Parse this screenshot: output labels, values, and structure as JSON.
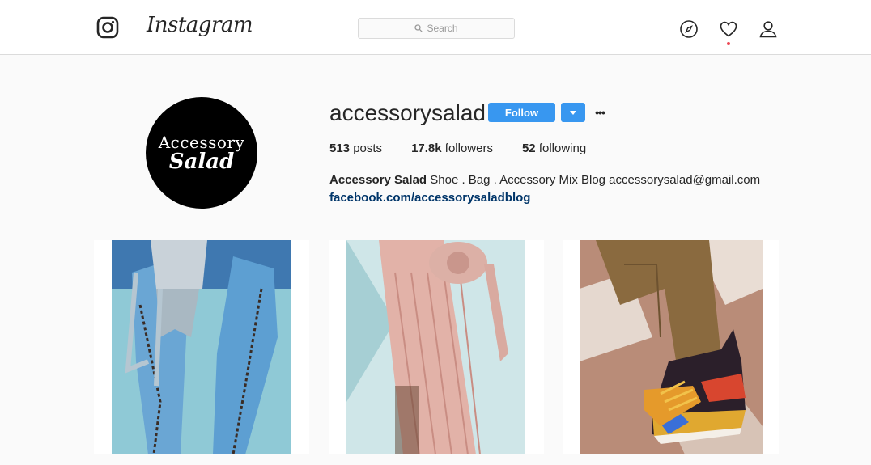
{
  "header": {
    "wordmark": "Instagram",
    "search_placeholder": "Search",
    "icons": [
      "instagram-glyph-icon",
      "search-icon",
      "compass-icon",
      "heart-icon",
      "user-icon"
    ]
  },
  "profile": {
    "username": "accessorysalad",
    "follow_label": "Follow",
    "more_label": "•••",
    "avatar_text_1": "Accessory",
    "avatar_text_2": "Salad",
    "stats": {
      "posts_count": "513",
      "posts_label": "posts",
      "followers_count": "17.8k",
      "followers_label": "followers",
      "following_count": "52",
      "following_label": "following"
    },
    "bio": {
      "name": "Accessory Salad",
      "text": "Shoe . Bag . Accessory Mix Blog accessorysalad@gmail.com",
      "link": "facebook.com/accessorysaladblog"
    }
  },
  "posts": [
    {
      "subject": "denim lace-up thigh boots with fringed bag"
    },
    {
      "subject": "pink fringe boots with round studded bag"
    },
    {
      "subject": "colorful sneakers with olive trousers"
    }
  ],
  "colors": {
    "accent": "#3897f0",
    "link": "#003569",
    "notification": "#ed4956",
    "background": "#fafafa",
    "border": "#dbdbdb"
  }
}
